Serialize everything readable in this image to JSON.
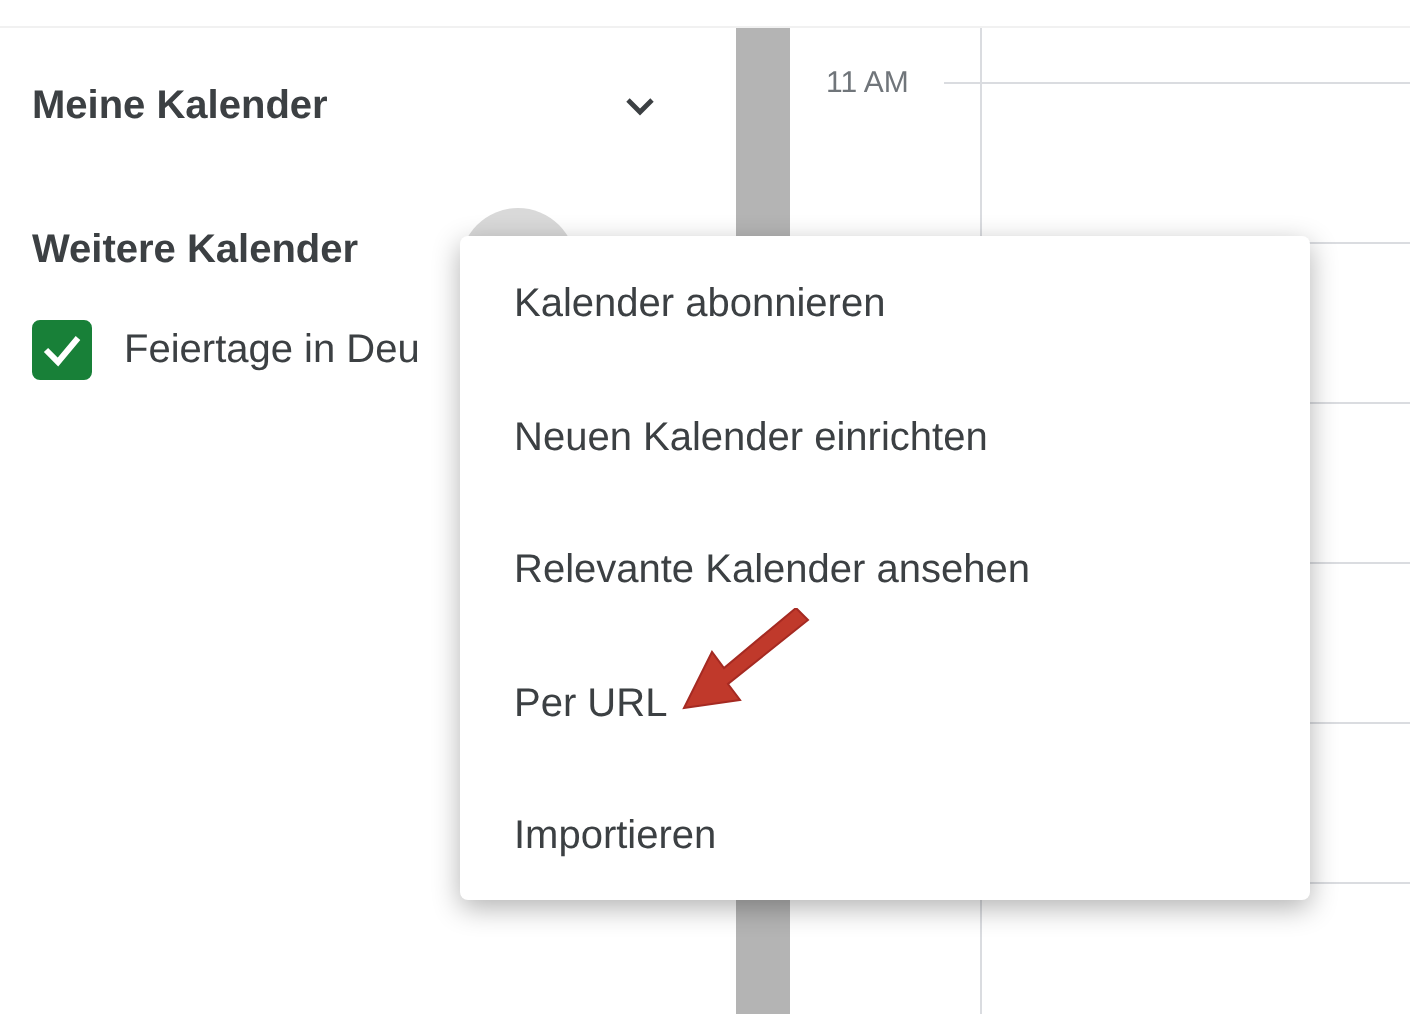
{
  "sidebar": {
    "sections": [
      {
        "title": "Meine Kalender",
        "expandable": true
      },
      {
        "title": "Weitere Kalender"
      }
    ],
    "calendars": [
      {
        "name": "Feiertage in Deu",
        "checked": true,
        "color": "#188038"
      }
    ]
  },
  "time_labels": [
    "11 AM"
  ],
  "menu": {
    "items": [
      "Kalender abonnieren",
      "Neuen Kalender einrichten",
      "Relevante Kalender ansehen",
      "Per URL",
      "Importieren"
    ]
  }
}
